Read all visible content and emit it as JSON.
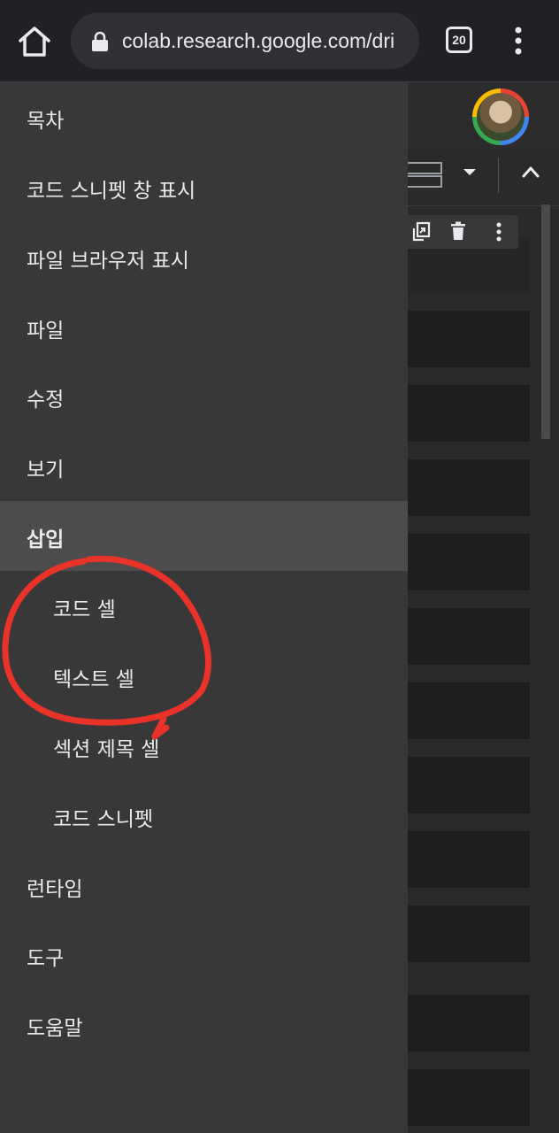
{
  "browser": {
    "url": "colab.research.google.com/dri",
    "tab_count": "20",
    "icons": {
      "home": "home-icon",
      "lock": "lock-icon",
      "overflow": "more-vert-icon"
    }
  },
  "menu": {
    "items": [
      {
        "label": "목차",
        "level": "top",
        "active": false
      },
      {
        "label": "코드 스니펫 창 표시",
        "level": "top",
        "active": false
      },
      {
        "label": "파일 브라우저 표시",
        "level": "top",
        "active": false
      },
      {
        "label": "파일",
        "level": "top",
        "active": false
      },
      {
        "label": "수정",
        "level": "top",
        "active": false
      },
      {
        "label": "보기",
        "level": "top",
        "active": false
      },
      {
        "label": "삽입",
        "level": "top",
        "active": true
      },
      {
        "label": "코드 셀",
        "level": "sub",
        "active": false
      },
      {
        "label": "텍스트 셀",
        "level": "sub",
        "active": false
      },
      {
        "label": "섹션 제목 셀",
        "level": "sub",
        "active": false
      },
      {
        "label": "코드 스니펫",
        "level": "sub",
        "active": false
      },
      {
        "label": "런타임",
        "level": "top",
        "active": false
      },
      {
        "label": "도구",
        "level": "top",
        "active": false
      },
      {
        "label": "도움말",
        "level": "top",
        "active": false
      }
    ]
  },
  "colors": {
    "drawer_bg": "#383838",
    "active_item_bg": "#4c4c4c",
    "annotation": "#e8322a"
  }
}
